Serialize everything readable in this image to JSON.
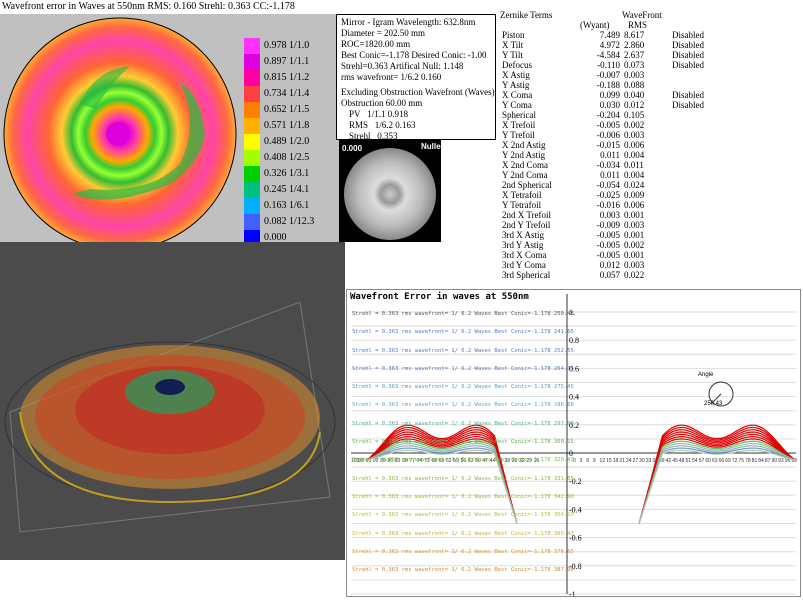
{
  "header": {
    "title": "Wavefront error in Waves at 550nm  RMS: 0.160 Strehl: 0.363 CC:-1.178"
  },
  "colors": {
    "contour_bg": "#c0c0c0",
    "dark_panel": "#4b4b4b",
    "wave_red": "#e00000"
  },
  "colorbar": [
    {
      "label": "0.978 1/1.0",
      "color": "#ff33ff"
    },
    {
      "label": "0.897 1/1.1",
      "color": "#e000e0"
    },
    {
      "label": "0.815 1/1.2",
      "color": "#ff00a0"
    },
    {
      "label": "0.734 1/1.4",
      "color": "#ff4040"
    },
    {
      "label": "0.652 1/1.5",
      "color": "#ff8000"
    },
    {
      "label": "0.571 1/1.8",
      "color": "#ffb000"
    },
    {
      "label": "0.489 1/2.0",
      "color": "#ffff00"
    },
    {
      "label": "0.408 1/2.5",
      "color": "#a0ff00"
    },
    {
      "label": "0.326 1/3.1",
      "color": "#00d000"
    },
    {
      "label": "0.245 1/4.1",
      "color": "#00c080"
    },
    {
      "label": "0.163 1/6.1",
      "color": "#00b0ff"
    },
    {
      "label": "0.082 1/12.3",
      "color": "#4060ff"
    },
    {
      "label": "0.000",
      "color": "#0000ff"
    }
  ],
  "info": {
    "line1": "Mirror - Igram Wavelength: 632.8nm",
    "line2": "Diameter = 202.50 mm",
    "line3": "ROC=1820.00 mm",
    "line4": "Best Conic=-1.178 Desired Conic: -1.00",
    "line5": " Strehl=0.363  Artifical Null: 1.148",
    "line6": "rms wavefront= 1/6.2  0.160",
    "line7": "Excluding Obstruction Wavefront (Waves)",
    "line8": "Obstruction 60.00 mm",
    "pv_label": "PV",
    "pv_value": "1/1.1  0.918",
    "rms_label": "RMS",
    "rms_value": "1/6.2  0.163",
    "strehl_label": "Strehl",
    "strehl_value": "0.353"
  },
  "interferogram": {
    "left_label": "0.000",
    "right_label": "Nulled"
  },
  "zernike": {
    "title": "Zernike Terms",
    "col2_header": "(Wyant)",
    "col3_header": "WaveFront",
    "col3_sub": "RMS",
    "rows": [
      {
        "name": "Piston",
        "wyant": "7.489",
        "rms": "8.617",
        "status": "Disabled"
      },
      {
        "name": "X Tilt",
        "wyant": "4.972",
        "rms": "2.860",
        "status": "Disabled"
      },
      {
        "name": "Y Tilt",
        "wyant": "-4.584",
        "rms": "2.637",
        "status": "Disabled"
      },
      {
        "name": "Defocus",
        "wyant": "-0.110",
        "rms": "0.073",
        "status": "Disabled"
      },
      {
        "name": "X Astig",
        "wyant": "-0.007",
        "rms": "0.003",
        "status": ""
      },
      {
        "name": "Y Astig",
        "wyant": "-0.188",
        "rms": "0.088",
        "status": ""
      },
      {
        "name": "X Coma",
        "wyant": "0.099",
        "rms": "0.040",
        "status": "Disabled"
      },
      {
        "name": "Y Coma",
        "wyant": "0.030",
        "rms": "0.012",
        "status": "Disabled"
      },
      {
        "name": "Spherical",
        "wyant": "-0.204",
        "rms": "0.105",
        "status": ""
      },
      {
        "name": "X Trefoil",
        "wyant": "-0.005",
        "rms": "0.002",
        "status": ""
      },
      {
        "name": "Y Trefoil",
        "wyant": "-0.006",
        "rms": "0.003",
        "status": ""
      },
      {
        "name": "X 2nd Astig",
        "wyant": "-0.015",
        "rms": "0.006",
        "status": ""
      },
      {
        "name": "Y 2nd Astig",
        "wyant": "0.011",
        "rms": "0.004",
        "status": ""
      },
      {
        "name": "X 2nd Coma",
        "wyant": "-0.034",
        "rms": "0.011",
        "status": ""
      },
      {
        "name": "Y 2nd Coma",
        "wyant": "0.011",
        "rms": "0.004",
        "status": ""
      },
      {
        "name": "2nd Spherical",
        "wyant": "-0.054",
        "rms": "0.024",
        "status": ""
      },
      {
        "name": "X Tetrafoil",
        "wyant": "-0.025",
        "rms": "0.009",
        "status": ""
      },
      {
        "name": "Y Tetrafoil",
        "wyant": "-0.016",
        "rms": "0.006",
        "status": ""
      },
      {
        "name": "2nd X Trefoil",
        "wyant": "0.003",
        "rms": "0.001",
        "status": ""
      },
      {
        "name": "2nd Y Trefoil",
        "wyant": "-0.009",
        "rms": "0.003",
        "status": ""
      },
      {
        "name": "3rd X Astig",
        "wyant": "-0.005",
        "rms": "0.001",
        "status": ""
      },
      {
        "name": "3rd Y Astig",
        "wyant": "-0.005",
        "rms": "0.002",
        "status": ""
      },
      {
        "name": "3rd X Coma",
        "wyant": "-0.005",
        "rms": "0.001",
        "status": ""
      },
      {
        "name": "3rd Y Coma",
        "wyant": "0.012",
        "rms": "0.003",
        "status": ""
      },
      {
        "name": "3rd Spherical",
        "wyant": "0.057",
        "rms": "0.022",
        "status": ""
      }
    ]
  },
  "plot": {
    "title": "Wavefront Error in waves at 550nm",
    "legend": [
      {
        "text": "Strehl = 0.363 rms wavefront= 1/ 6.2 Waves Best Conic=-1.178 250.43",
        "color": "#555555"
      },
      {
        "text": "Strehl = 0.363 rms wavefront= 1/ 6.2 Waves Best Conic=-1.178 241.65",
        "color": "#5577cc"
      },
      {
        "text": "Strehl = 0.363 rms wavefront= 1/ 6.2 Waves Best Conic=-1.178 252.55",
        "color": "#5577cc"
      },
      {
        "text": "Strehl = 0.363 rms wavefront= 1/ 6.2 Waves Best Conic=-1.178 264.15",
        "color": "#5577cc"
      },
      {
        "text": "Strehl = 0.363 rms wavefront= 1/ 6.2 Waves Best Conic=-1.178 275.45",
        "color": "#5599cc"
      },
      {
        "text": "Strehl = 0.363 rms wavefront= 1/ 6.2 Waves Best Conic=-1.178 286.68",
        "color": "#55aacc"
      },
      {
        "text": "Strehl = 0.363 rms wavefront= 1/ 6.2 Waves Best Conic=-1.178 297.90",
        "color": "#55aa88"
      },
      {
        "text": "Strehl = 0.363 rms wavefront= 1/ 6.2 Waves Best Conic=-1.178 309.15",
        "color": "#66aa55"
      },
      {
        "text": "Strehl = 0.363 rms wavefront= 1/ 6.2 Waves Best Conic=-1.178 320.43",
        "color": "#77bb44"
      },
      {
        "text": "Strehl = 0.363 rms wavefront= 1/ 6.2 Waves Best Conic=-1.178 331.65",
        "color": "#88bb33"
      },
      {
        "text": "Strehl = 0.363 rms wavefront= 1/ 6.2 Waves Best Conic=-1.178 342.90",
        "color": "#99bb33"
      },
      {
        "text": "Strehl = 0.363 rms wavefront= 1/ 6.2 Waves Best Conic=-1.178 354.15",
        "color": "#bbbb33"
      },
      {
        "text": "Strehl = 0.363 rms wavefront= 1/ 6.2 Waves Best Conic=-1.178 365.43",
        "color": "#ccaa33"
      },
      {
        "text": "Strehl = 0.363 rms wavefront= 1/ 6.2 Waves Best Conic=-1.178 376.65",
        "color": "#cc9933"
      },
      {
        "text": "Strehl = 0.363 rms wavefront= 1/ 6.2 Waves Best Conic=-1.178 387.90",
        "color": "#cc8833"
      }
    ],
    "angle_label": "Angle",
    "angle_value": "250.43",
    "x_ticks_left": [
      "101",
      "98",
      "95",
      "92",
      "89",
      "86",
      "83",
      "80",
      "77",
      "74",
      "71",
      "68",
      "65",
      "62",
      "59",
      "56",
      "53",
      "50",
      "47",
      "44",
      "41",
      "38",
      "35",
      "32",
      "29",
      "26"
    ],
    "x_ticks_right": [
      "0",
      "3",
      "6",
      "9",
      "12",
      "15",
      "18",
      "21",
      "24",
      "27",
      "30",
      "33",
      "36",
      "39",
      "42",
      "45",
      "48",
      "51",
      "54",
      "57",
      "60",
      "63",
      "66",
      "69",
      "72",
      "75",
      "78",
      "81",
      "84",
      "87",
      "90",
      "93",
      "96",
      "99"
    ]
  },
  "chart_data": {
    "type": "line",
    "title": "Wavefront Error in waves at 550nm",
    "xlabel": "",
    "ylabel": "",
    "ylim": [
      -1,
      1
    ],
    "y_ticks": [
      "1.",
      "0.8",
      "0.6",
      "0.4",
      "0.2",
      "0",
      "-0.2",
      "-0.4",
      "-0.6",
      "-0.8",
      "-1."
    ],
    "grid": true
  }
}
